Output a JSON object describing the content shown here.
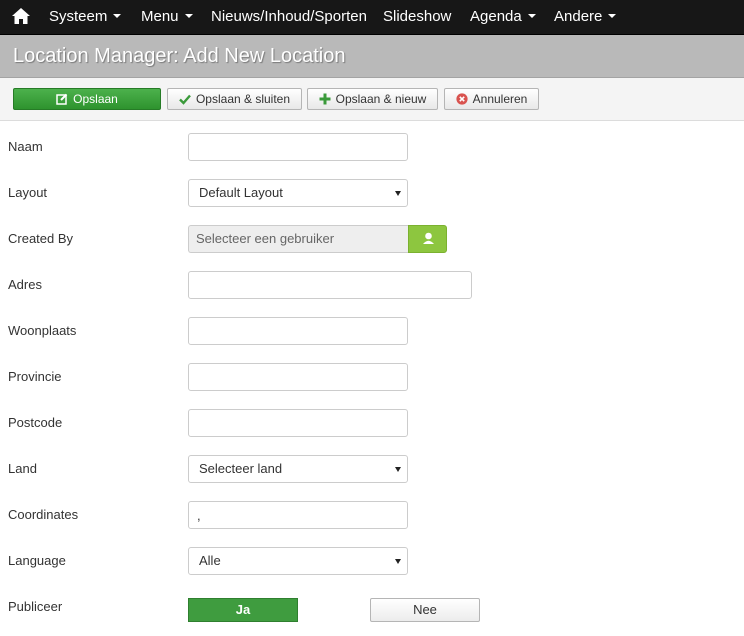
{
  "nav": {
    "items": [
      {
        "label": "Systeem",
        "dropdown": true
      },
      {
        "label": "Menu",
        "dropdown": true
      },
      {
        "label": "Nieuws/Inhoud/Sporten",
        "dropdown": false
      },
      {
        "label": "Slideshow",
        "dropdown": false
      },
      {
        "label": "Agenda",
        "dropdown": true
      },
      {
        "label": "Andere",
        "dropdown": true
      }
    ]
  },
  "page": {
    "title": "Location Manager: Add New Location"
  },
  "toolbar": {
    "save": "Opslaan",
    "save_close": "Opslaan & sluiten",
    "save_new": "Opslaan & nieuw",
    "cancel": "Annuleren"
  },
  "form": {
    "naam": {
      "label": "Naam",
      "value": ""
    },
    "layout": {
      "label": "Layout",
      "selected": "Default Layout"
    },
    "created_by": {
      "label": "Created By",
      "placeholder": "Selecteer een gebruiker"
    },
    "adres": {
      "label": "Adres",
      "value": ""
    },
    "woonplaats": {
      "label": "Woonplaats",
      "value": ""
    },
    "provincie": {
      "label": "Provincie",
      "value": ""
    },
    "postcode": {
      "label": "Postcode",
      "value": ""
    },
    "land": {
      "label": "Land",
      "selected": "Selecteer land"
    },
    "coordinates": {
      "label": "Coordinates",
      "value": ","
    },
    "language": {
      "label": "Language",
      "selected": "Alle"
    },
    "publiceer": {
      "label": "Publiceer",
      "yes": "Ja",
      "no": "Nee",
      "value": "Ja"
    }
  },
  "colors": {
    "navbar": "#171717",
    "titlebar": "#b9b9b9",
    "primary_green": "#3f9c3f",
    "user_button_green": "#8dc63f",
    "cancel_red": "#d9534f"
  },
  "icons": {
    "home": "home-icon",
    "save": "edit-icon",
    "save_close": "check-icon",
    "save_new": "plus-icon",
    "cancel": "cancel-circle-icon",
    "user": "user-icon"
  }
}
